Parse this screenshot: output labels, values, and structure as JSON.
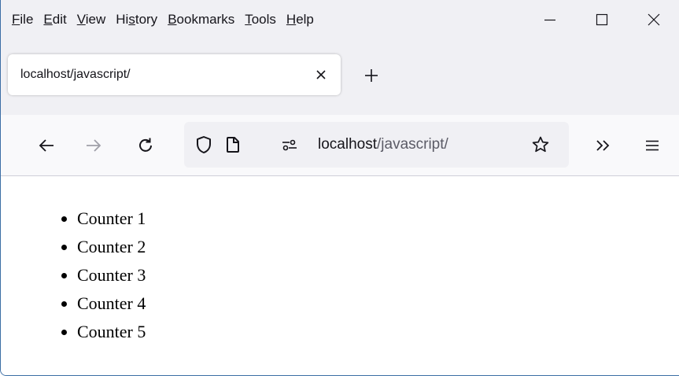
{
  "menu": {
    "items": [
      {
        "pre": "",
        "acc": "F",
        "post": "ile"
      },
      {
        "pre": "",
        "acc": "E",
        "post": "dit"
      },
      {
        "pre": "",
        "acc": "V",
        "post": "iew"
      },
      {
        "pre": "Hi",
        "acc": "s",
        "post": "tory"
      },
      {
        "pre": "",
        "acc": "B",
        "post": "ookmarks"
      },
      {
        "pre": "",
        "acc": "T",
        "post": "ools"
      },
      {
        "pre": "",
        "acc": "H",
        "post": "elp"
      }
    ]
  },
  "window_controls": {
    "minimize_icon": "minimize-icon",
    "maximize_icon": "maximize-icon",
    "close_icon": "close-icon"
  },
  "tab": {
    "title": "localhost/javascript/",
    "close_icon": "close-icon",
    "new_tab_icon": "plus-icon"
  },
  "navbar": {
    "icons": [
      "back-arrow-icon",
      "forward-arrow-icon",
      "reload-icon",
      "shield-icon",
      "page-icon",
      "permissions-icon",
      "star-icon",
      "chevron-double-right-icon",
      "hamburger-menu-icon"
    ],
    "url_host": "localhost",
    "url_path": "/javascript/"
  },
  "content": {
    "list": [
      "Counter 1",
      "Counter 2",
      "Counter 3",
      "Counter 4",
      "Counter 5"
    ]
  },
  "colors": {
    "chrome_bg": "#f0f0f4",
    "toolbar_bg": "#f9f9fb",
    "text": "#15141a",
    "muted_text": "#5b5b66",
    "window_border": "#3b6ea5"
  }
}
